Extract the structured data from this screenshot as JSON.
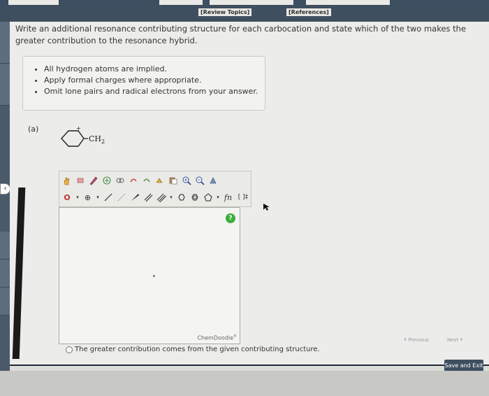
{
  "header": {
    "review_topics": "[Review Topics]",
    "references": "[References]"
  },
  "question": {
    "text": "Write an additional resonance contributing structure for each carbocation and state which of the two makes the greater contribution to the resonance hybrid."
  },
  "hints": [
    "All hydrogen atoms are implied.",
    "Apply formal charges where appropriate.",
    "Omit lone pairs and radical electrons from your answer."
  ],
  "part": {
    "label": "(a)",
    "charge": "+",
    "substituent": "CH",
    "substituent_sub": "2"
  },
  "chemdoodle": {
    "help": "?",
    "label": "ChemDoodle",
    "reg": "®",
    "row1_icons": [
      "hand-icon",
      "eraser-icon",
      "pencil-icon",
      "zoom-fit-icon",
      "ring-fusion-icon",
      "undo-icon",
      "redo-icon",
      "template-icon",
      "copy-icon",
      "zoom-in-icon",
      "zoom-out-icon",
      "clean-icon"
    ],
    "row2_labels": [
      "O",
      "⊕",
      "fn",
      "[ ]‡"
    ]
  },
  "answer": {
    "text": "The greater contribution comes from the given contributing structure."
  },
  "nav": {
    "prev": "Previous",
    "next": "Next"
  },
  "save_exit": "Save and Exit"
}
